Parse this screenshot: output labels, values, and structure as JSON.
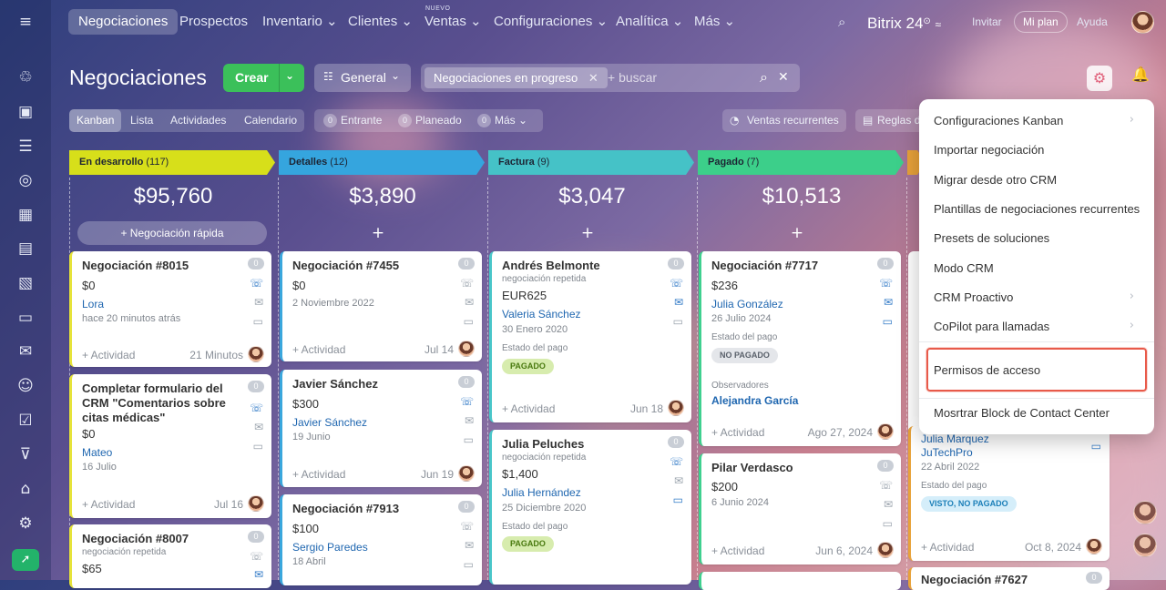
{
  "nav": {
    "items": [
      "Negociaciones",
      "Prospectos",
      "Inventario",
      "Clientes",
      "Ventas",
      "Configuraciones",
      "Analítica",
      "Más"
    ],
    "nuevo_label": "NUEVO",
    "brand": "Bitrix 24",
    "invite": "Invitar",
    "plan": "Mi plan",
    "help": "Ayuda"
  },
  "header": {
    "title": "Negociaciones",
    "create_label": "Crear",
    "general_label": "General",
    "filter_chip": "Negociaciones en progreso",
    "search_placeholder": "+ buscar"
  },
  "view_tabs": [
    "Kanban",
    "Lista",
    "Actividades",
    "Calendario"
  ],
  "counters": [
    {
      "n": "0",
      "label": "Entrante"
    },
    {
      "n": "0",
      "label": "Planeado"
    },
    {
      "n": "0",
      "label": "Más"
    }
  ],
  "toolbar": {
    "ventas": "Ventas recurrentes",
    "reglas": "Reglas d"
  },
  "columns": [
    {
      "name": "En desarrollo",
      "count": "(117)",
      "sum": "$95,760",
      "color": "#d7df1a",
      "quick": "Negociación rápida"
    },
    {
      "name": "Detalles",
      "count": "(12)",
      "sum": "$3,890",
      "color": "#35a5de"
    },
    {
      "name": "Factura",
      "count": "(9)",
      "sum": "$3,047",
      "color": "#45c2c7"
    },
    {
      "name": "Pagado",
      "count": "(7)",
      "sum": "$10,513",
      "color": "#3ccf8a"
    }
  ],
  "plus": "+",
  "cards": {
    "c1": {
      "title": "Negociación #8015",
      "amount": "$0",
      "contact": "Lora",
      "time": "hace 20 minutos atrás",
      "activity": "+ Actividad",
      "date": "21 Minutos",
      "badge": "0"
    },
    "c2": {
      "title": "Completar formulario del CRM \"Comentarios sobre citas médicas\"",
      "amount": "$0",
      "contact": "Mateo",
      "date0": "16 Julio",
      "activity": "+ Actividad",
      "date": "Jul 16",
      "badge": "0"
    },
    "c3": {
      "title": "Negociación #8007",
      "sub": "negociación repetida",
      "amount": "$65",
      "badge": "0"
    },
    "c4": {
      "title": "Negociación #7455",
      "amount": "$0",
      "date0": "2 Noviembre 2022",
      "activity": "+ Actividad",
      "date": "Jul 14",
      "badge": "0"
    },
    "c5": {
      "title": "Javier Sánchez",
      "amount": "$300",
      "contact": "Javier Sánchez",
      "date0": "19 Junio",
      "activity": "+ Actividad",
      "date": "Jun 19",
      "badge": "0"
    },
    "c6": {
      "title": "Negociación #7913",
      "amount": "$100",
      "contact": "Sergio Paredes",
      "date0": "18 Abril",
      "badge": "0"
    },
    "c7": {
      "title": "Andrés Belmonte",
      "sub": "negociación repetida",
      "amount": "EUR625",
      "contact": "Valeria Sánchez",
      "date0": "30 Enero 2020",
      "state_label": "Estado del pago",
      "state": "PAGADO",
      "activity": "+ Actividad",
      "date": "Jun 18",
      "badge": "0"
    },
    "c8": {
      "title": "Julia Peluches",
      "sub": "negociación repetida",
      "amount": "$1,400",
      "contact": "Julia Hernández",
      "date0": "25 Diciembre 2020",
      "state_label": "Estado del pago",
      "state": "PAGADO",
      "badge": "0"
    },
    "c9": {
      "title": "Negociación #7717",
      "amount": "$236",
      "contact": "Julia González",
      "date0": "26 Julio 2024",
      "state_label": "Estado del pago",
      "state": "NO PAGADO",
      "obs_label": "Observadores",
      "obs": "Alejandra García",
      "activity": "+ Actividad",
      "date": "Ago 27, 2024",
      "badge": "0"
    },
    "c10": {
      "title": "Pilar Verdasco",
      "amount": "$200",
      "date0": "6 Junio 2024",
      "activity": "+ Actividad",
      "date": "Jun 6, 2024",
      "badge": "0"
    },
    "c11": {
      "contact": "Julia Marquez",
      "company": "JuTechPro",
      "date0": "22 Abril 2022",
      "state_label": "Estado del pago",
      "state": "VISTO, NO PAGADO",
      "activity": "+ Actividad",
      "date": "Oct 8, 2024"
    },
    "c12": {
      "title": "Negociación #7627",
      "badge": "0"
    }
  },
  "menu": {
    "items": [
      "Configuraciones Kanban",
      "Importar negociación",
      "Migrar desde otro CRM",
      "Plantillas de negociaciones recurrentes",
      "Presets de soluciones",
      "Modo CRM",
      "CRM Proactivo",
      "CoPilot para llamadas",
      "Permisos de acceso",
      "Mosrtrar Block de Contact Center"
    ]
  },
  "icons": {
    "phone": "☏",
    "mail": "✉",
    "chat": "▭",
    "gear": "⚙",
    "bell": "🔔",
    "search": "⌕",
    "close": "✕",
    "chevron": "›",
    "caret": "⌄"
  }
}
